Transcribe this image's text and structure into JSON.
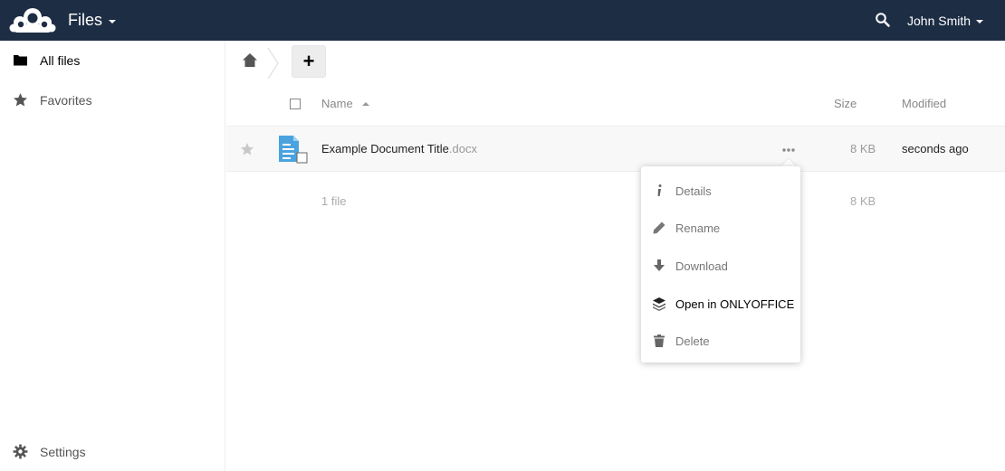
{
  "header": {
    "app_name": "Files",
    "user_name": "John Smith",
    "background": "#1d2d44"
  },
  "sidebar": {
    "items": [
      {
        "label": "All files",
        "icon": "folder-icon"
      },
      {
        "label": "Favorites",
        "icon": "star-icon"
      }
    ],
    "settings_label": "Settings"
  },
  "toolbar": {
    "new_label": "+"
  },
  "table": {
    "columns": {
      "name": "Name",
      "size": "Size",
      "modified": "Modified"
    },
    "rows": [
      {
        "name": "Example Document Title",
        "extension": ".docx",
        "size": "8 KB",
        "modified": "seconds ago"
      }
    ],
    "summary": {
      "count": "1 file",
      "size": "8 KB"
    }
  },
  "file_menu": {
    "items": [
      {
        "label": "Details",
        "icon": "info-icon"
      },
      {
        "label": "Rename",
        "icon": "pencil-icon"
      },
      {
        "label": "Download",
        "icon": "download-icon"
      },
      {
        "label": "Open in ONLYOFFICE",
        "icon": "onlyoffice-icon"
      },
      {
        "label": "Delete",
        "icon": "trash-icon"
      }
    ]
  }
}
